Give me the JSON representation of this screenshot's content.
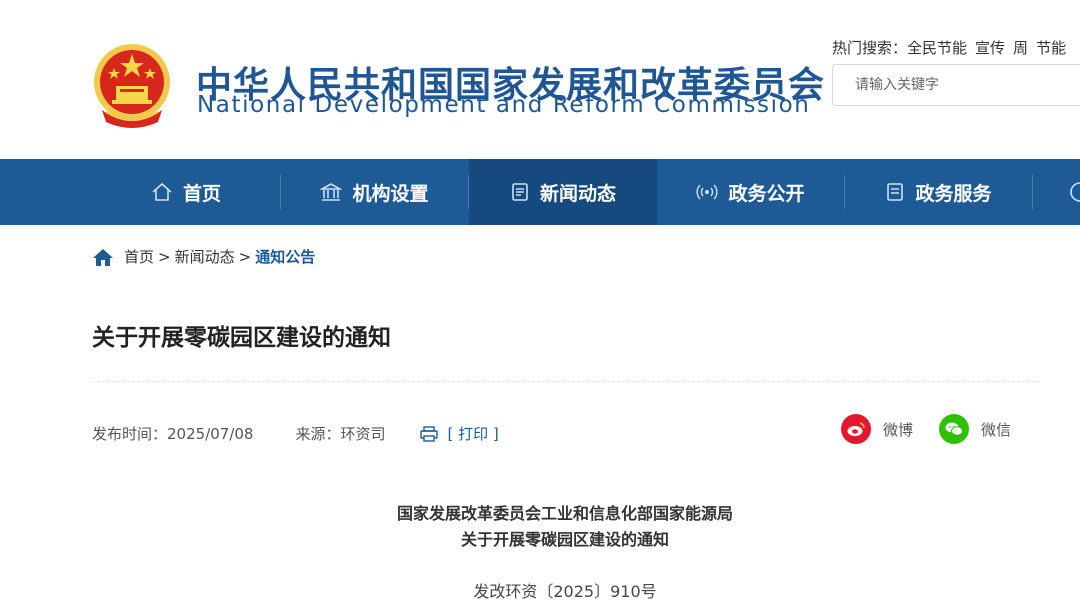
{
  "header": {
    "org_name_cn": "中华人民共和国国家发展和改革委员会",
    "org_name_en": "National Development and Reform Commission",
    "hot_search": {
      "label": "热门搜索：",
      "keywords": [
        "全民节能",
        "宣传",
        "周",
        "节能"
      ]
    },
    "search": {
      "placeholder": "请输入关键字"
    }
  },
  "nav": {
    "items": [
      {
        "label": "首页",
        "icon": "home-icon"
      },
      {
        "label": "机构设置",
        "icon": "institution-icon"
      },
      {
        "label": "新闻动态",
        "icon": "news-icon",
        "active": true
      },
      {
        "label": "政务公开",
        "icon": "broadcast-icon"
      },
      {
        "label": "政务服务",
        "icon": "document-icon"
      }
    ]
  },
  "breadcrumb": {
    "items": [
      "首页",
      "新闻动态",
      "通知公告"
    ],
    "separator": ">"
  },
  "article": {
    "title": "关于开展零碳园区建设的通知",
    "publish_label": "发布时间：",
    "publish_date": "2025/07/08",
    "source_label": "来源：",
    "source": "环资司",
    "print_label": "[ 打印 ]",
    "share": {
      "weibo": "微博",
      "wechat": "微信"
    },
    "body_heading_1": "国家发展改革委员会工业和信息化部国家能源局",
    "body_heading_2": "关于开展零碳园区建设的通知",
    "doc_number": "发改环资〔2025〕910号"
  },
  "colors": {
    "brand_blue": "#1d5a96",
    "nav_active": "#164a7f",
    "weibo_red": "#e6162d",
    "wechat_green": "#2dc100"
  }
}
